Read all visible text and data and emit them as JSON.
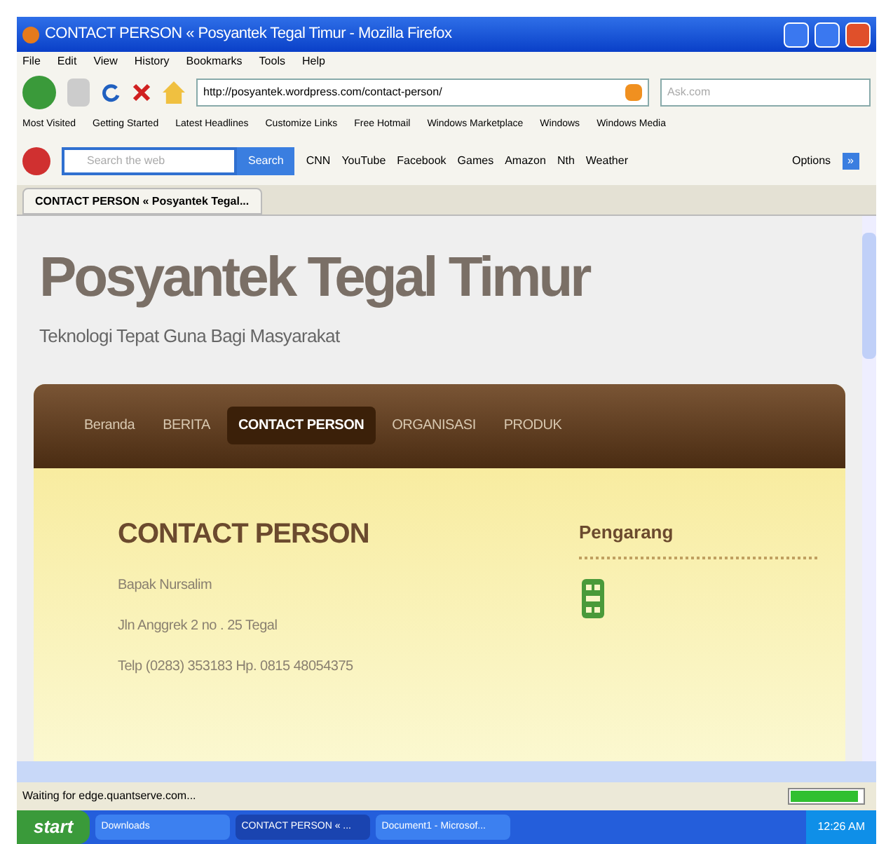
{
  "window": {
    "title": "CONTACT PERSON « Posyantek Tegal Timur - Mozilla Firefox"
  },
  "menu": [
    "File",
    "Edit",
    "View",
    "History",
    "Bookmarks",
    "Tools",
    "Help"
  ],
  "address": {
    "value": "http://posyantek.wordpress.com/contact-person/"
  },
  "search_engine": {
    "placeholder": "Ask.com"
  },
  "bookmarks": [
    "Most Visited",
    "Getting Started",
    "Latest Headlines",
    "Customize Links",
    "Free Hotmail",
    "Windows Marketplace",
    "Windows",
    "Windows Media"
  ],
  "ask_toolbar": {
    "placeholder": "Search the web",
    "button": "Search",
    "items": [
      "CNN",
      "YouTube",
      "Facebook",
      "Games",
      "Amazon",
      "Nth",
      "Weather"
    ],
    "options": "Options",
    "more": "»"
  },
  "tabs": [
    {
      "label": "CONTACT PERSON « Posyantek Tegal...",
      "selected": true
    }
  ],
  "page": {
    "site_title": "Posyantek Tegal Timur",
    "tagline": "Teknologi Tepat Guna Bagi Masyarakat",
    "nav": [
      {
        "label": "Beranda",
        "selected": false
      },
      {
        "label": "BERITA",
        "selected": false
      },
      {
        "label": "CONTACT PERSON",
        "selected": true
      },
      {
        "label": "ORGANISASI",
        "selected": false
      },
      {
        "label": "PRODUK",
        "selected": false
      }
    ],
    "heading": "CONTACT PERSON",
    "lines": [
      "Bapak Nursalim",
      "Jln Anggrek 2 no . 25 Tegal",
      "Telp (0283) 353183 Hp. 0815 48054375"
    ],
    "sidebar_heading": "Pengarang"
  },
  "status_bar": {
    "text": "Waiting for edge.quantserve.com...",
    "level": 0.95
  },
  "taskbar": {
    "start": "start",
    "items": [
      {
        "label": "Downloads",
        "selected": false
      },
      {
        "label": "CONTACT PERSON « ...",
        "selected": true
      },
      {
        "label": "Document1 - Microsof...",
        "selected": false
      }
    ],
    "clock": "12:26 AM"
  }
}
